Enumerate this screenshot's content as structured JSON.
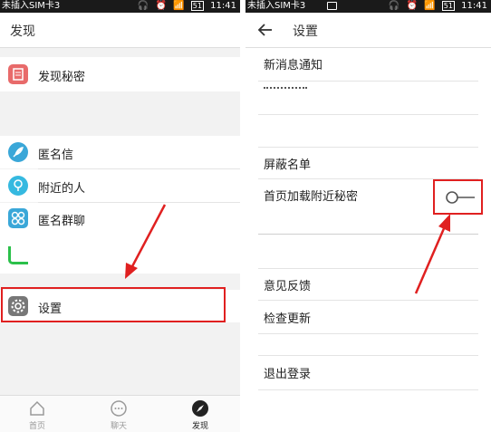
{
  "left": {
    "status": {
      "carrier": "未插入SIM卡3",
      "battery": "51",
      "time": "11:41"
    },
    "header_title": "发现",
    "items": [
      {
        "label": "发现秘密",
        "icon": "document-icon"
      },
      {
        "label": "匿名信",
        "icon": "feather-icon"
      },
      {
        "label": "附近的人",
        "icon": "location-pin-icon"
      },
      {
        "label": "匿名群聊",
        "icon": "group-chat-icon"
      },
      {
        "label": "设置",
        "icon": "gear-icon"
      }
    ],
    "tabs": [
      {
        "label": "首页",
        "icon": "home-icon"
      },
      {
        "label": "聊天",
        "icon": "chat-bubble-icon"
      },
      {
        "label": "发现",
        "icon": "compass-icon"
      }
    ]
  },
  "right": {
    "status": {
      "carrier": "未插入SIM卡3",
      "battery": "51",
      "time": "11:41"
    },
    "header_title": "设置",
    "items": [
      {
        "label": "新消息通知"
      },
      {
        "label": "屏蔽名单"
      },
      {
        "label": "首页加载附近秘密"
      },
      {
        "label": "意见反馈"
      },
      {
        "label": "检查更新"
      },
      {
        "label": "退出登录"
      }
    ]
  },
  "colors": {
    "annotation_red": "#e02020",
    "toggle_off": "#555555",
    "icon_doc": "#e86a6a",
    "icon_feather": "#3aa7d8",
    "icon_pin": "#35b9e0",
    "icon_group": "#3aa7d8",
    "icon_green": "#2bc04a",
    "icon_gear": "#777777"
  }
}
